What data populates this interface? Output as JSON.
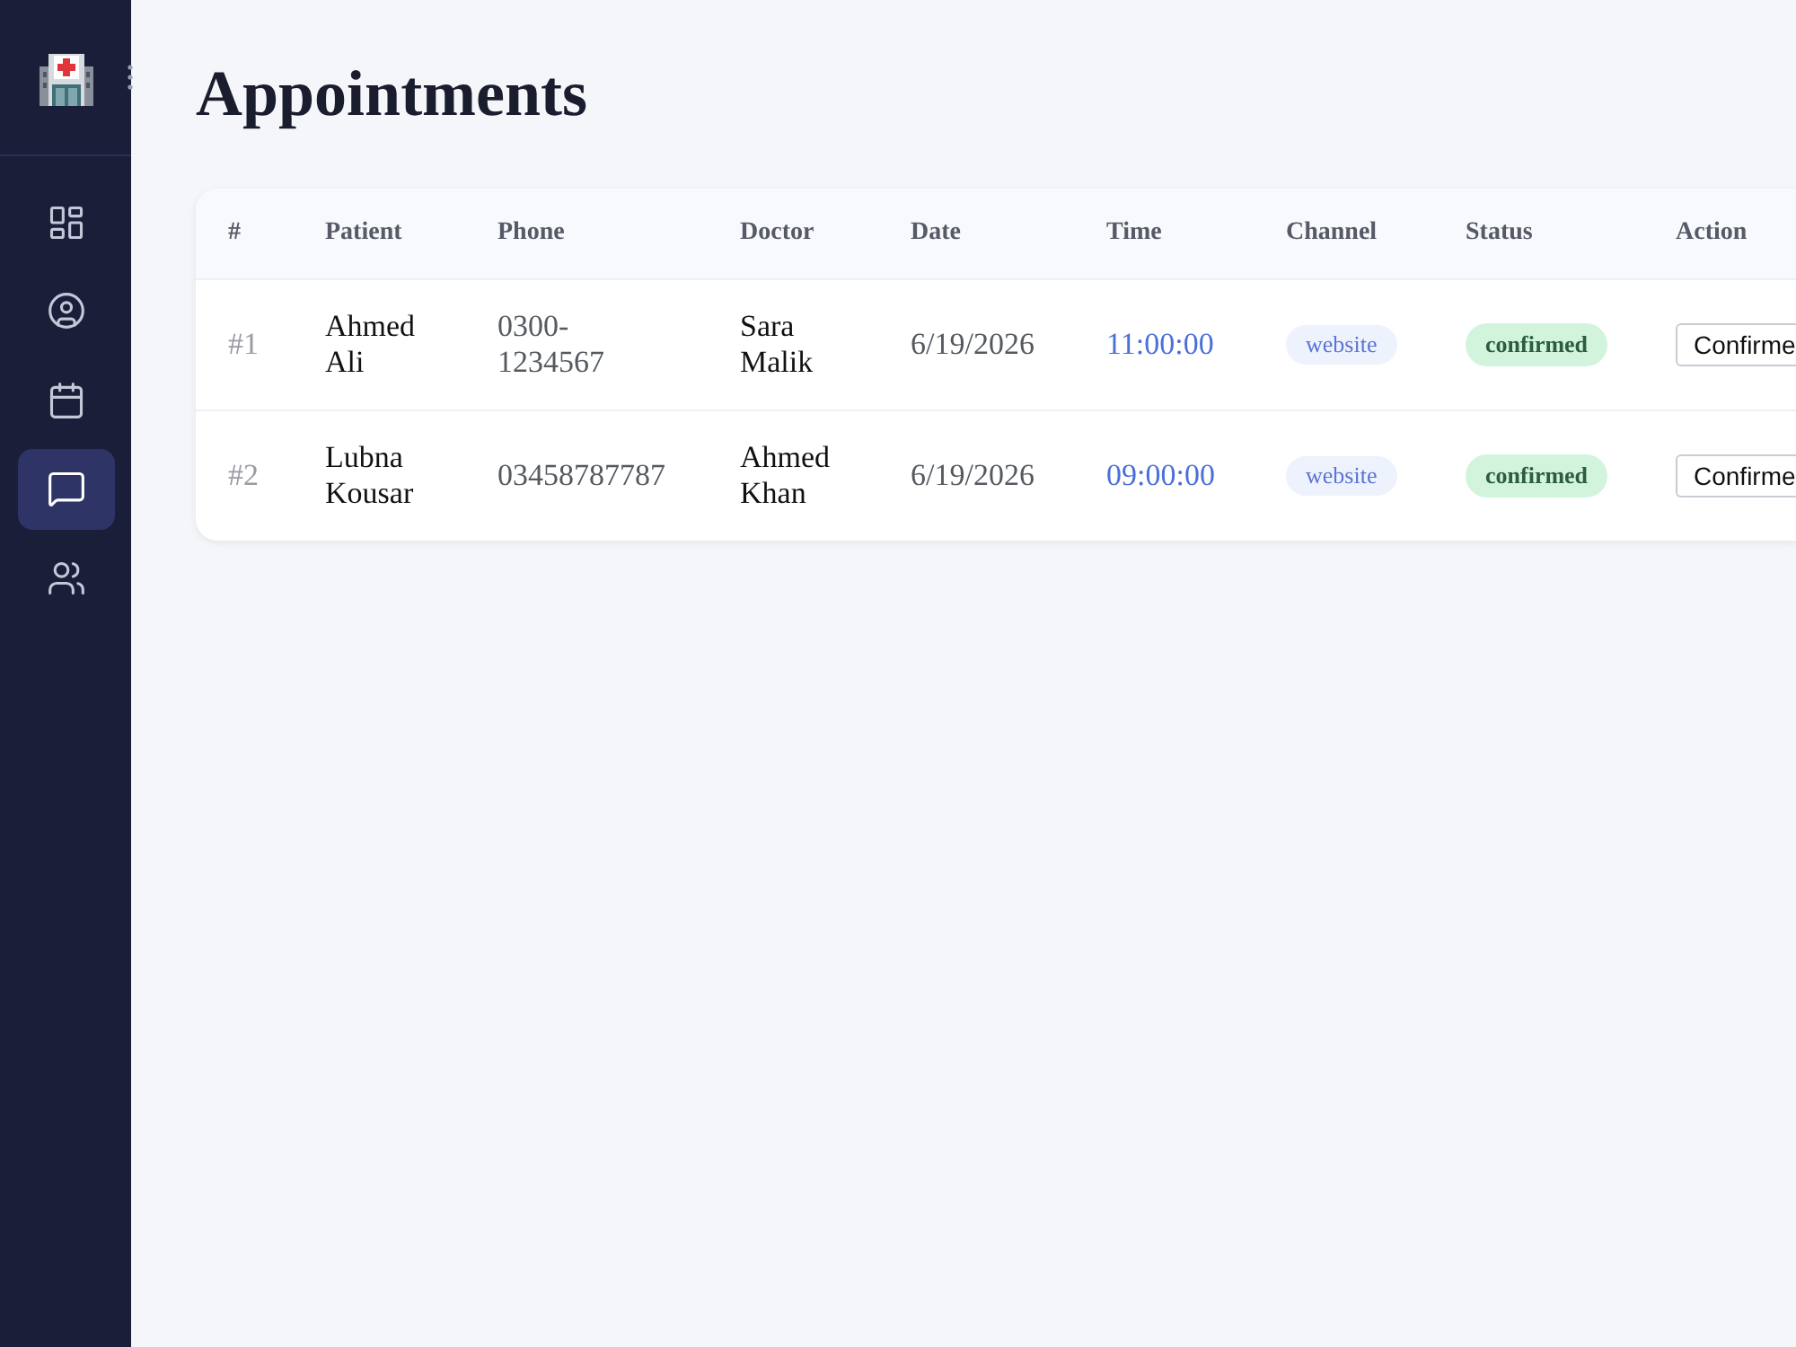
{
  "sidebar": {
    "items": [
      {
        "selected": false
      },
      {
        "selected": false
      },
      {
        "selected": false
      },
      {
        "selected": true
      },
      {
        "selected": false
      }
    ]
  },
  "page": {
    "title": "Appointments"
  },
  "table": {
    "columns": [
      "#",
      "Patient",
      "Phone",
      "Doctor",
      "Date",
      "Time",
      "Channel",
      "Status",
      "Action"
    ],
    "rows": [
      {
        "number": "#1",
        "patient": "Ahmed Ali",
        "phone": "0300-1234567",
        "doctor": "Sara Malik",
        "date": "6/19/2026",
        "time": "11:00:00",
        "channel": "website",
        "status": "confirmed",
        "action": "Confirme"
      },
      {
        "number": "#2",
        "patient": "Lubna Kousar",
        "phone": "03458787787",
        "doctor": "Ahmed Khan",
        "date": "6/19/2026",
        "time": "09:00:00",
        "channel": "website",
        "status": "confirmed",
        "action": "Confirme"
      }
    ]
  }
}
